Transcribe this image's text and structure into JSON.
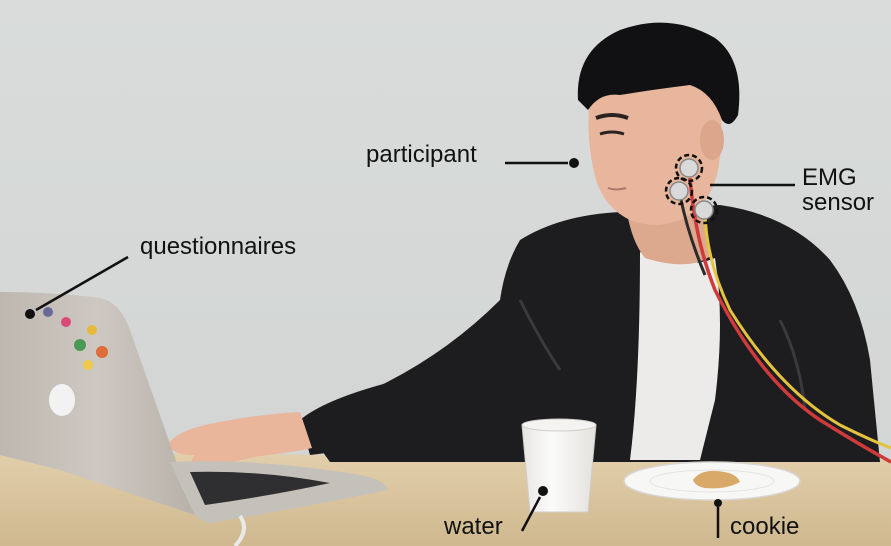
{
  "labels": {
    "participant": "participant",
    "questionnaires": "questionnaires",
    "emg_line1": "EMG",
    "emg_line2": "sensor",
    "water": "water",
    "cookie": "cookie"
  },
  "colors": {
    "background": "#dadcdb",
    "table": "#dcc9a4",
    "jacket": "#1c1c1e",
    "skin": "#e9b9a0",
    "laptop": "#c7c2bb",
    "wire_red": "#d2393b",
    "wire_yellow": "#e6c23b"
  }
}
